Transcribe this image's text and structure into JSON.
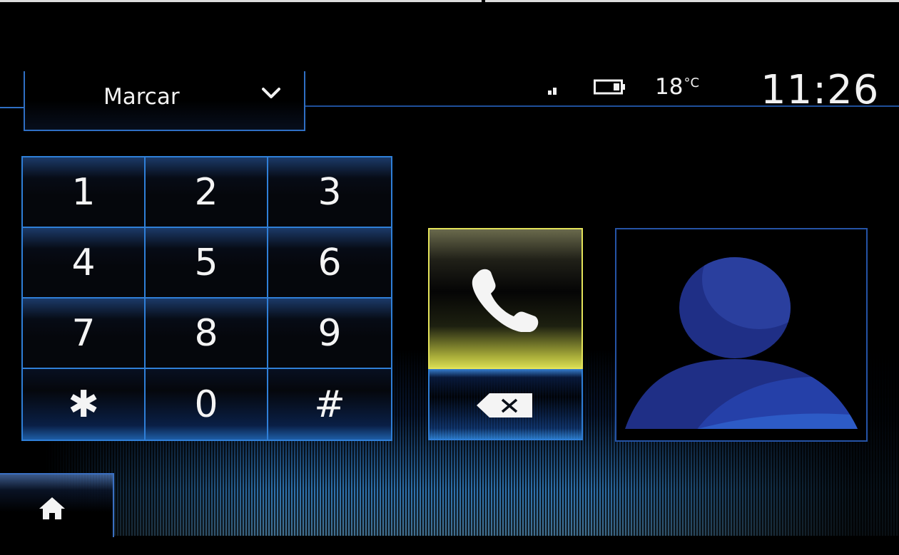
{
  "header": {
    "mode_label": "Marcar",
    "chevron_icon": "chevron-down-icon"
  },
  "status": {
    "signal_icon": "signal-icon",
    "battery_icon": "battery-icon",
    "temperature": "18",
    "temperature_unit": "°C",
    "clock": "11:26"
  },
  "keypad": {
    "keys": [
      {
        "label": "1"
      },
      {
        "label": "2"
      },
      {
        "label": "3"
      },
      {
        "label": "4"
      },
      {
        "label": "5"
      },
      {
        "label": "6"
      },
      {
        "label": "7"
      },
      {
        "label": "8"
      },
      {
        "label": "9"
      },
      {
        "label": "✱"
      },
      {
        "label": "0"
      },
      {
        "label": "#"
      }
    ]
  },
  "actions": {
    "call_icon": "phone-icon",
    "backspace_icon": "backspace-icon"
  },
  "contact": {
    "avatar_icon": "person-silhouette-icon"
  },
  "nav": {
    "home_icon": "home-icon"
  },
  "colors": {
    "accent_blue": "#2f7fd8",
    "call_yellow": "#e4e35a",
    "background": "#000000",
    "avatar_blue": "#2a3f9a"
  }
}
